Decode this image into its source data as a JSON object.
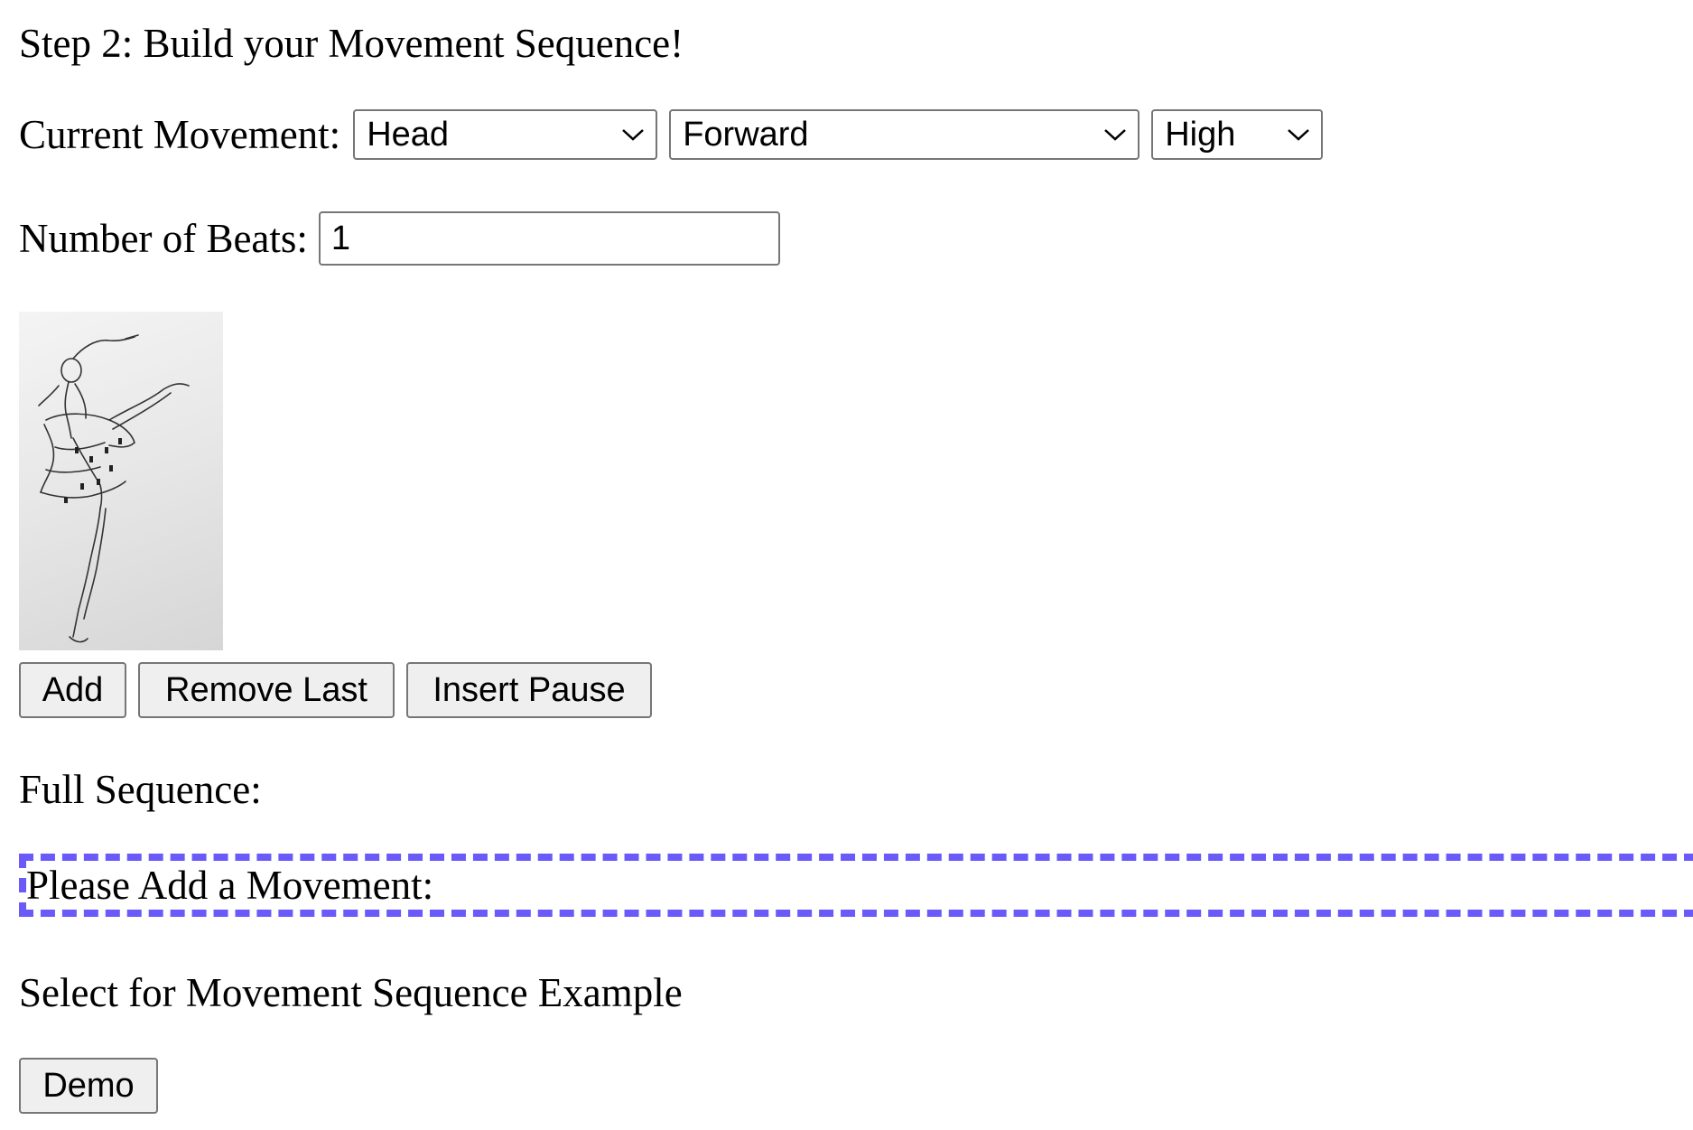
{
  "step_title": "Step 2: Build your Movement Sequence!",
  "movement": {
    "label": "Current Movement:",
    "body_part": "Head",
    "direction": "Forward",
    "level": "High"
  },
  "beats": {
    "label": "Number of Beats:",
    "value": "1"
  },
  "image": {
    "alt": "ballerina-sketch"
  },
  "buttons": {
    "add": "Add",
    "remove_last": "Remove Last",
    "insert_pause": "Insert Pause",
    "demo": "Demo"
  },
  "sequence": {
    "label": "Full Sequence:",
    "empty_text": "Please Add a Movement:"
  },
  "example": {
    "label": "Select for Movement Sequence Example"
  },
  "colors": {
    "focus_outline": "#6a5af9"
  },
  "icons": {
    "dropdown": "chevron-down-icon"
  }
}
